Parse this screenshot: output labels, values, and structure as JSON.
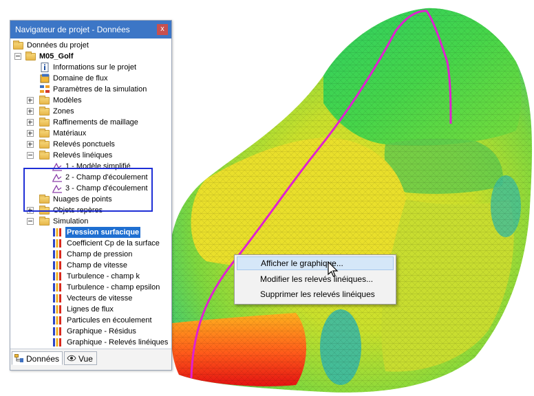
{
  "navigator": {
    "title": "Navigateur de projet - Données",
    "close_glyph": "x",
    "tree": {
      "root": "Données du projet",
      "project": "M05_Golf",
      "project_info": "Informations sur le projet",
      "flow_domain": "Domaine de flux",
      "sim_params": "Paramètres de la simulation",
      "models": "Modèles",
      "zones": "Zones",
      "mesh_refinements": "Raffinements de maillage",
      "materials": "Matériaux",
      "point_probes": "Relevés ponctuels",
      "line_probes": "Relevés linéiques",
      "line_probe_items": [
        "1 - Modèle simplifié",
        "2 - Champ d'écoulement",
        "3 - Champ d'écoulement"
      ],
      "point_clouds": "Nuages de points",
      "guide_objects": "Objets repères",
      "simulation": "Simulation",
      "simulation_items": [
        "Pression surfacique",
        "Coefficient Cp de la surface",
        "Champ de pression",
        "Champ de vitesse",
        "Turbulence - champ k",
        "Turbulence - champ epsilon",
        "Vecteurs de vitesse",
        "Lignes de flux",
        "Particules en écoulement",
        "Graphique - Résidus",
        "Graphique - Relevés linéiques"
      ]
    },
    "tabs": [
      "Données",
      "Vue"
    ]
  },
  "context_menu": {
    "items": [
      "Afficher le graphique...",
      "Modifier les relevés linéiques...",
      "Supprimer les relevés linéiques"
    ]
  },
  "colors": {
    "title_bar": "#3c76c6",
    "selection": "#1f6fd1",
    "highlight_frame": "#1e2ed6",
    "probe_line": "#e020d0"
  },
  "icons": {
    "folder": "folder-icon",
    "info": "info-document-icon",
    "domain": "flow-domain-icon",
    "params": "simulation-parameters-icon",
    "line_probe": "line-probe-icon",
    "result": "result-color-bars-icon",
    "cursor": "mouse-pointer-icon"
  }
}
